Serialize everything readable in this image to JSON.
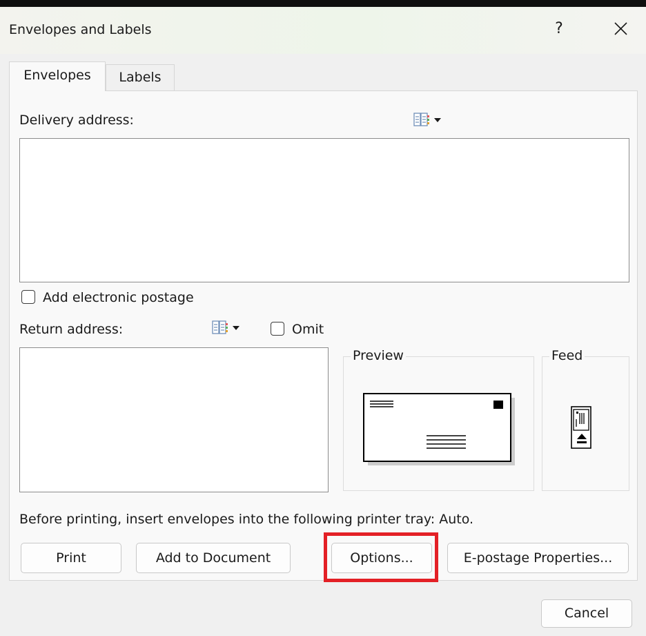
{
  "window": {
    "title": "Envelopes and Labels",
    "help_label": "?",
    "close_icon": "close-icon"
  },
  "tabs": [
    {
      "label": "Envelopes",
      "active": true
    },
    {
      "label": "Labels",
      "active": false
    }
  ],
  "delivery": {
    "label": "Delivery address:",
    "value": "",
    "address_book_icon": "address-book-icon"
  },
  "electronic_postage": {
    "label": "Add electronic postage",
    "checked": false
  },
  "return": {
    "label": "Return address:",
    "value": "",
    "address_book_icon": "address-book-icon",
    "omit_label": "Omit",
    "omit_checked": false
  },
  "preview": {
    "title": "Preview"
  },
  "feed": {
    "title": "Feed"
  },
  "printer_tray_text": "Before printing, insert envelopes into the following printer tray: Auto.",
  "buttons": {
    "print": "Print",
    "add_to_document": "Add to Document",
    "options": "Options...",
    "epostage": "E-postage Properties...",
    "cancel": "Cancel"
  },
  "colors": {
    "highlight": "#e32026"
  }
}
